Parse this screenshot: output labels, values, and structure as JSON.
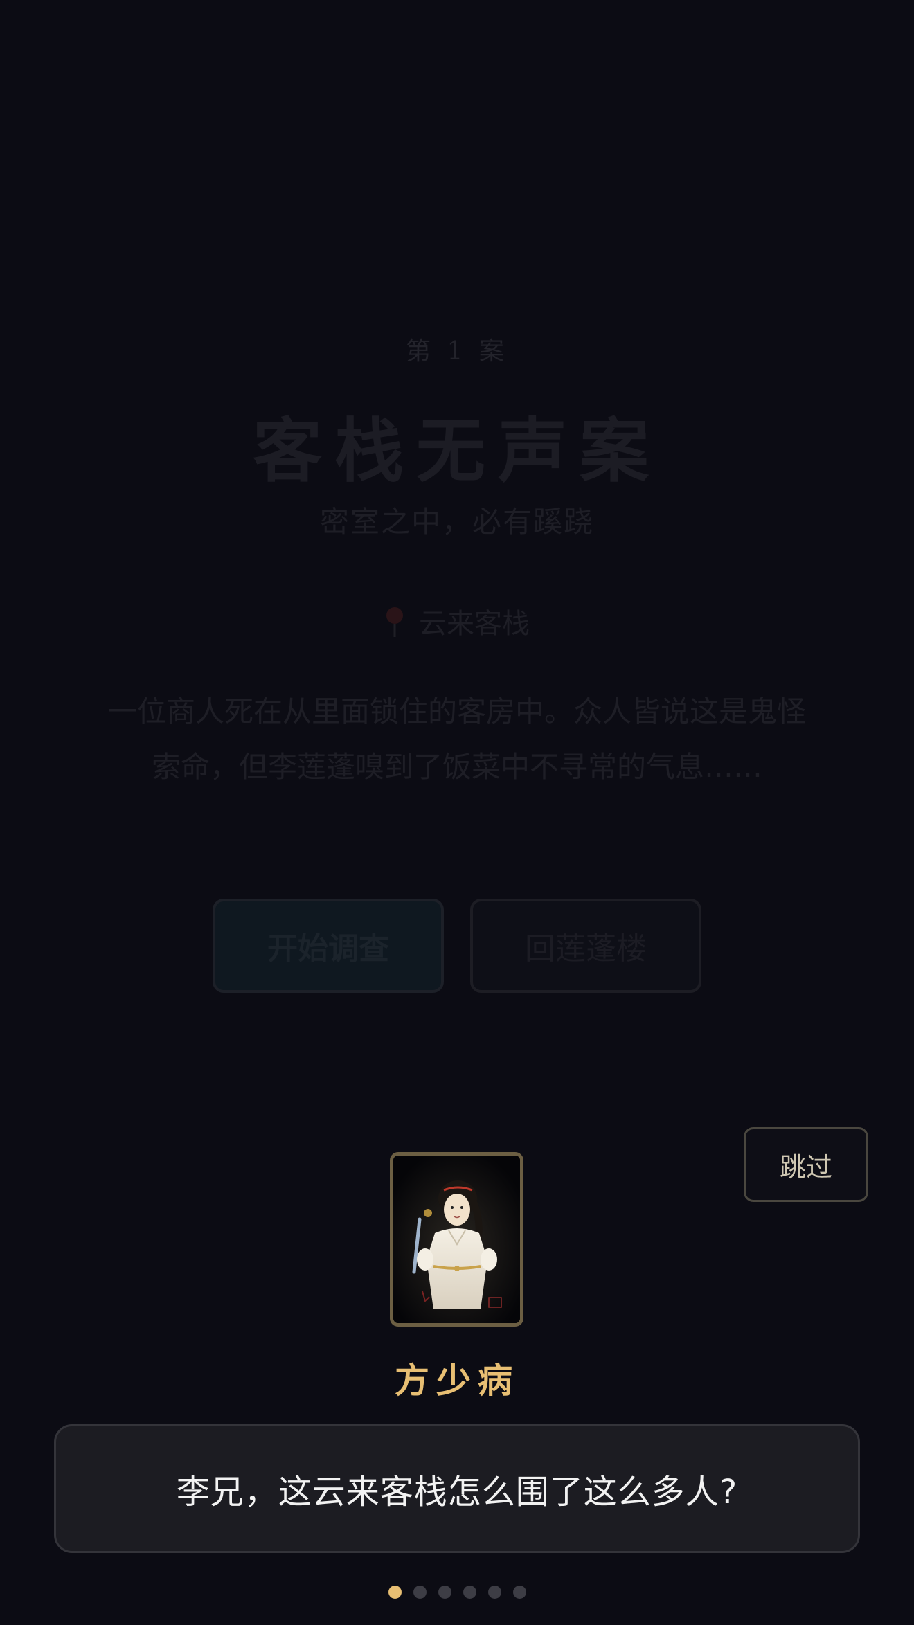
{
  "case_intro": {
    "case_number": "第 1 案",
    "title": "客栈无声案",
    "subtitle": "密室之中，必有蹊跷",
    "location": "云来客栈",
    "description_line1": "一位商人死在从里面锁住的客房中。众人皆说这是鬼怪",
    "description_line2": "索命，但李莲蓬嗅到了饭菜中不寻常的气息……",
    "start_label": "开始调查",
    "back_label": "回莲蓬楼"
  },
  "dialogue": {
    "skip_label": "跳过",
    "speaker": "方少病",
    "text": "李兄，这云来客栈怎么围了这么多人?"
  },
  "pager": {
    "total": 6,
    "active_index": 0
  },
  "colors": {
    "background": "#0c0c14",
    "accent_gold": "#e8bf73",
    "dialogue_bg": "#1c1c22"
  }
}
